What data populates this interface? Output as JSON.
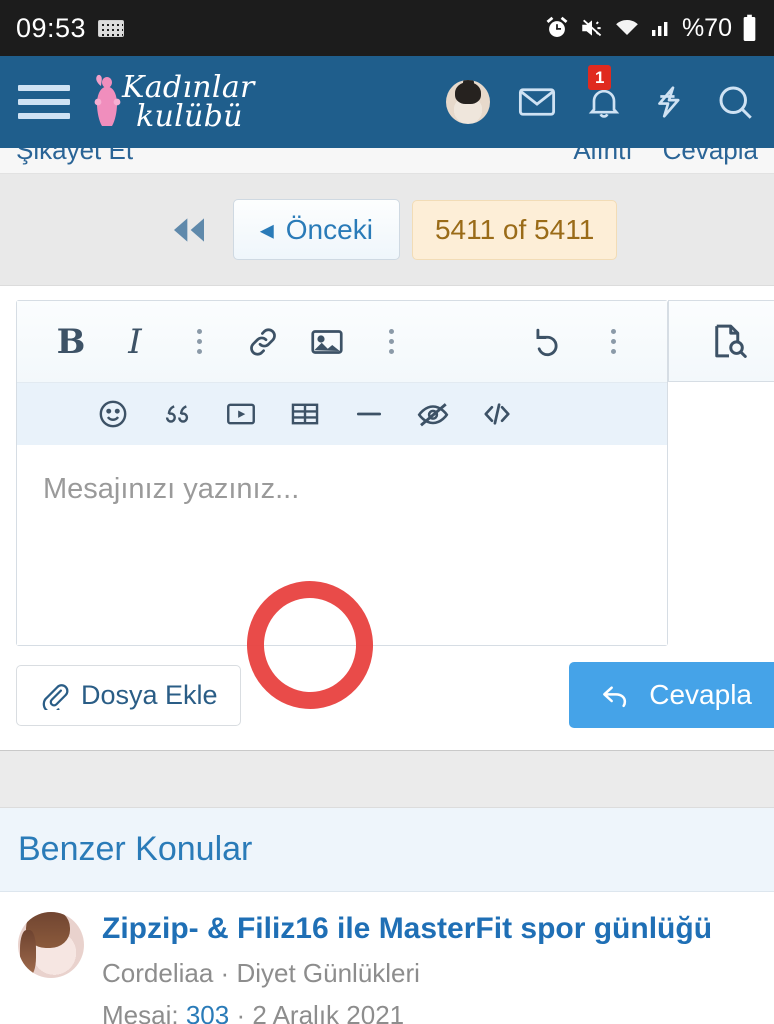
{
  "statusbar": {
    "time": "09:53",
    "keyboard_icon": "keyboard-icon",
    "alarm_icon": "alarm-icon",
    "mute_icon": "volume-mute-icon",
    "wifi_icon": "wifi-icon",
    "signal_icon": "cellular-signal-icon",
    "battery_text": "%70",
    "battery_icon": "battery-icon"
  },
  "header": {
    "menu_icon": "hamburger-menu-icon",
    "logo_line1": "Kadınlar",
    "logo_line2": "kulübü",
    "avatar": "user-avatar",
    "inbox_icon": "envelope-icon",
    "alerts_icon": "bell-icon",
    "alerts_badge": "1",
    "bolt_icon": "lightning-bolt-icon",
    "search_icon": "search-icon"
  },
  "post_actions": {
    "report": "Şikayet Et",
    "quote": "Alıntı",
    "reply": "Cevapla"
  },
  "pagination": {
    "first_icon": "first-page-icon",
    "prev_label": "Önceki",
    "prev_arrow": "◂",
    "counter": "5411 of 5411"
  },
  "editor": {
    "toolbar_row1": [
      {
        "name": "bold-button",
        "label": "B",
        "type": "text"
      },
      {
        "name": "italic-button",
        "label": "I",
        "type": "text"
      },
      {
        "name": "more-formatting-button",
        "label": "",
        "type": "vdots"
      },
      {
        "name": "insert-link-button",
        "label": "",
        "type": "link"
      },
      {
        "name": "insert-image-button",
        "label": "",
        "type": "image"
      },
      {
        "name": "more-insert-button",
        "label": "",
        "type": "vdots"
      }
    ],
    "toolbar_row1_right": [
      {
        "name": "undo-button",
        "label": "",
        "type": "undo"
      },
      {
        "name": "more-options-button",
        "label": "",
        "type": "vdots"
      }
    ],
    "preview_button": "document-preview-icon",
    "toolbar_row2": [
      {
        "name": "insert-smilie-button",
        "type": "smiley"
      },
      {
        "name": "insert-quote-button",
        "type": "quote"
      },
      {
        "name": "insert-media-button",
        "type": "media"
      },
      {
        "name": "insert-table-button",
        "type": "table"
      },
      {
        "name": "insert-horizontal-rule-button",
        "type": "hr"
      },
      {
        "name": "insert-spoiler-button",
        "type": "eye-slash"
      },
      {
        "name": "insert-code-button",
        "type": "code"
      }
    ],
    "placeholder": "Mesajınızı yazınız...",
    "attach_label": "Dosya Ekle",
    "attach_icon": "paperclip-icon",
    "reply_label": "Cevapla",
    "reply_icon": "reply-arrow-icon"
  },
  "annotation": {
    "shape": "hand-drawn-red-ellipse",
    "color": "#e8413f",
    "target": "insert-image-button"
  },
  "similar": {
    "heading": "Benzer Konular",
    "threads": [
      {
        "title": "Zipzip- & Filiz16 ile MasterFit spor günlüğü",
        "author": "Cordeliaa",
        "separator": "·",
        "forum": "Diyet Günlükleri",
        "messages_label": "Mesaj:",
        "messages_count": "303",
        "date": "2 Aralık 2021"
      }
    ]
  },
  "colors": {
    "header_blue": "#1f5e8c",
    "link_blue": "#2a7bb8",
    "reply_button": "#45a3e8",
    "counter_bg": "#fdeed7",
    "annotation_red": "#e8413f"
  }
}
